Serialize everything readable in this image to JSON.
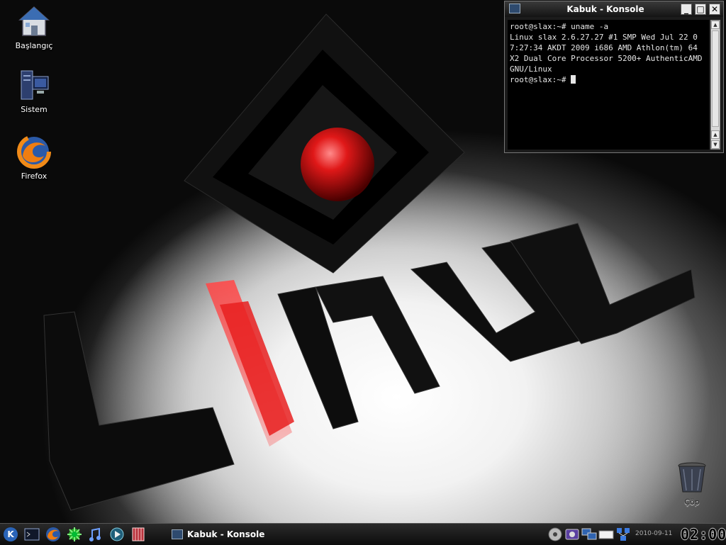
{
  "desktop": {
    "icons": [
      {
        "label": "Başlangıç",
        "icon": "home-icon"
      },
      {
        "label": "Sistem",
        "icon": "computer-icon"
      },
      {
        "label": "Firefox",
        "icon": "firefox-icon"
      },
      {
        "label": "Çöp",
        "icon": "trash-icon"
      }
    ]
  },
  "konsole": {
    "title": "Kabuk - Konsole",
    "buttons": {
      "minimize": "_",
      "maximize": "□",
      "close": "✕"
    },
    "lines": [
      "root@slax:~# uname -a",
      "Linux slax 2.6.27.27 #1 SMP Wed Jul 22 07:27:34 AKDT 2009 i686 AMD Athlon(tm) 64 X2 Dual Core Processor 5200+ AuthenticAMD GNU/Linux",
      "root@slax:~# "
    ]
  },
  "taskbar": {
    "launchers": [
      "kde-menu-icon",
      "terminal-icon",
      "firefox-icon",
      "kget-icon",
      "amarok-icon",
      "kaffeine-icon",
      "kdoc-icon"
    ],
    "task": "Kabuk - Konsole",
    "tray": [
      "media-icon",
      "klipper-icon",
      "network-icon",
      "keyboard-icon",
      "network-share-icon"
    ],
    "date": "2010-09-11",
    "clock": "02:00"
  },
  "colors": {
    "terminal_bg": "#000000",
    "terminal_fg": "#e6e6e6",
    "taskbar_bg": "#151515",
    "accent_red": "#cc1a1a"
  }
}
